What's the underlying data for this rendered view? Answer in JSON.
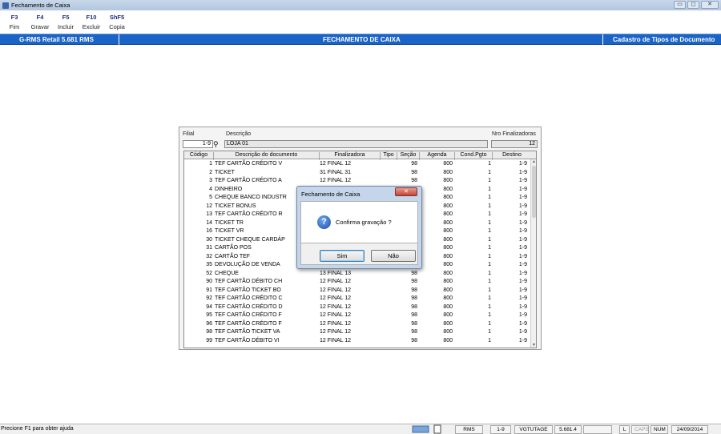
{
  "window": {
    "title": "Fechamento de Caixa",
    "controls": [
      "▭",
      "◻",
      "✕"
    ]
  },
  "toolbar": [
    {
      "key": "F3",
      "label": "Fim"
    },
    {
      "key": "F4",
      "label": "Gravar"
    },
    {
      "key": "F5",
      "label": "Incluir"
    },
    {
      "key": "F10",
      "label": "Excluir"
    },
    {
      "key": "ShF5",
      "label": "Copia"
    }
  ],
  "header_bar": {
    "left": "G-RMS Retail 5.681 RMS",
    "center": "FECHAMENTO DE CAIXA",
    "right": "Cadastro de Tipos de Documento",
    "color": "#1b64c7"
  },
  "form": {
    "filial_label": "Filial",
    "filial_value": "1-9",
    "descricao_label": "Descrição",
    "descricao_value": "LOJA 01",
    "nro_label": "Nro Finalizadoras",
    "nro_value": "12"
  },
  "table": {
    "columns": [
      "Código",
      "Descrição do documento",
      "Finalizadora",
      "Tipo",
      "Seção",
      "Agenda",
      "Cond.Pgto",
      "Destino"
    ],
    "rows": [
      [
        "1",
        "TEF CARTÃO CRÉDITO V",
        "12 FINAL 12",
        "",
        "98",
        "800",
        "1",
        "1-9"
      ],
      [
        "2",
        "TICKET",
        "31 FINAL 31",
        "",
        "98",
        "800",
        "1",
        "1-9"
      ],
      [
        "3",
        "TEF CARTÃO CRÉDITO A",
        "12 FINAL 12",
        "",
        "98",
        "800",
        "1",
        "1-9"
      ],
      [
        "4",
        "DINHEIRO",
        "",
        "",
        "",
        "800",
        "1",
        "1-9"
      ],
      [
        "5",
        "CHEQUE BANCO INDUSTR",
        "",
        "",
        "",
        "800",
        "1",
        "1-9"
      ],
      [
        "12",
        "TICKET BONUS",
        "",
        "",
        "",
        "800",
        "1",
        "1-9"
      ],
      [
        "13",
        "TEF CARTÃO CRÉDITO R",
        "",
        "",
        "",
        "800",
        "1",
        "1-9"
      ],
      [
        "14",
        "TICKET TR",
        "",
        "",
        "",
        "800",
        "1",
        "1-9"
      ],
      [
        "16",
        "TICKET VR",
        "",
        "",
        "",
        "800",
        "1",
        "1-9"
      ],
      [
        "30",
        "TICKET CHEQUE CARDÁP",
        "",
        "",
        "",
        "800",
        "1",
        "1-9"
      ],
      [
        "31",
        "CARTÃO POS",
        "",
        "",
        "",
        "800",
        "1",
        "1-9"
      ],
      [
        "32",
        "CARTÃO TEF",
        "",
        "",
        "",
        "800",
        "1",
        "1-9"
      ],
      [
        "35",
        "DEVOLUÇÃO DE VENDA",
        "",
        "",
        "",
        "800",
        "1",
        "1-9"
      ],
      [
        "52",
        "CHEQUE",
        "13 FINAL 13",
        "",
        "98",
        "800",
        "1",
        "1-9"
      ],
      [
        "90",
        "TEF CARTÃO DÉBITO CH",
        "12 FINAL 12",
        "",
        "98",
        "800",
        "1",
        "1-9"
      ],
      [
        "91",
        "TEF CARTÃO TICKET BO",
        "12 FINAL 12",
        "",
        "98",
        "800",
        "1",
        "1-9"
      ],
      [
        "92",
        "TEF CARTÃO CRÉDITO C",
        "12 FINAL 12",
        "",
        "98",
        "800",
        "1",
        "1-9"
      ],
      [
        "94",
        "TEF CARTÃO CRÉDITO D",
        "12 FINAL 12",
        "",
        "98",
        "800",
        "1",
        "1-9"
      ],
      [
        "95",
        "TEF CARTÃO CRÉDITO F",
        "12 FINAL 12",
        "",
        "98",
        "800",
        "1",
        "1-9"
      ],
      [
        "96",
        "TEF CARTÃO CRÉDITO F",
        "12 FINAL 12",
        "",
        "98",
        "800",
        "1",
        "1-9"
      ],
      [
        "98",
        "TEF CARTÃO TICKET VA",
        "12 FINAL 12",
        "",
        "98",
        "800",
        "1",
        "1-9"
      ],
      [
        "99",
        "TEF CARTÃO DÉBITO VI",
        "12 FINAL 12",
        "",
        "98",
        "800",
        "1",
        "1-9"
      ]
    ]
  },
  "dialog": {
    "title": "Fechamento de Caixa",
    "message": "Confirma gravação ?",
    "yes": "Sim",
    "no": "Não",
    "close": "✕"
  },
  "statusbar": {
    "help": "Precione F1 para obter ajuda",
    "fields": [
      "RMS",
      "1-9",
      "VGTUTAGE",
      "5.681.4",
      "",
      "L",
      "CAPS",
      "NUM",
      "24/09/2014"
    ]
  }
}
